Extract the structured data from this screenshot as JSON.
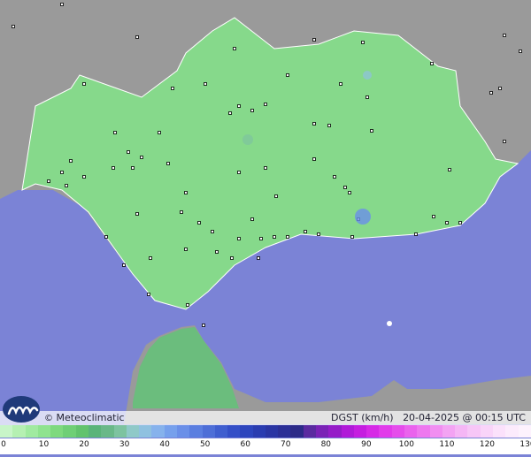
{
  "map": {
    "credit": "Meteoclimatic",
    "credit_symbol": "©",
    "variable": "DGST (km/h)",
    "timestamp": "20-04-2025 @ 00:15 UTC",
    "colors": {
      "sea": "#7b83d6",
      "land_outside": "#9a9a9a",
      "region_fill": "#86d98b",
      "africa_region": "#6bbd7d",
      "station_marker": "#000000"
    }
  },
  "legend": {
    "ticks": [
      "0",
      "10",
      "20",
      "30",
      "40",
      "50",
      "60",
      "70",
      "80",
      "90",
      "100",
      "110",
      "120",
      "130"
    ],
    "colors": [
      "#c8f5c8",
      "#b5f0b2",
      "#a0eaa0",
      "#8fe38f",
      "#7ed97e",
      "#6fcf76",
      "#62c36d",
      "#5ab47a",
      "#69b889",
      "#7dc3a0",
      "#8fc9c8",
      "#8fc1e0",
      "#86b2ec",
      "#76a0ec",
      "#6a8fe8",
      "#5a7ee0",
      "#4d6ed7",
      "#3f5ecf",
      "#344fc7",
      "#2d45bd",
      "#2a3cb0",
      "#2a35a3",
      "#2b2f96",
      "#2c2a88",
      "#5a2aa0",
      "#7a22b6",
      "#951cc8",
      "#b01ad8",
      "#c51ee0",
      "#d62ae6",
      "#e13bea",
      "#e54deb",
      "#ea63ed",
      "#ee78ef",
      "#f18ef1",
      "#f3a3f3",
      "#f5b6f5",
      "#f7c6f7",
      "#f9d4f9",
      "#fbe1fb",
      "#fcebfc",
      "#fdf2fd"
    ]
  }
}
